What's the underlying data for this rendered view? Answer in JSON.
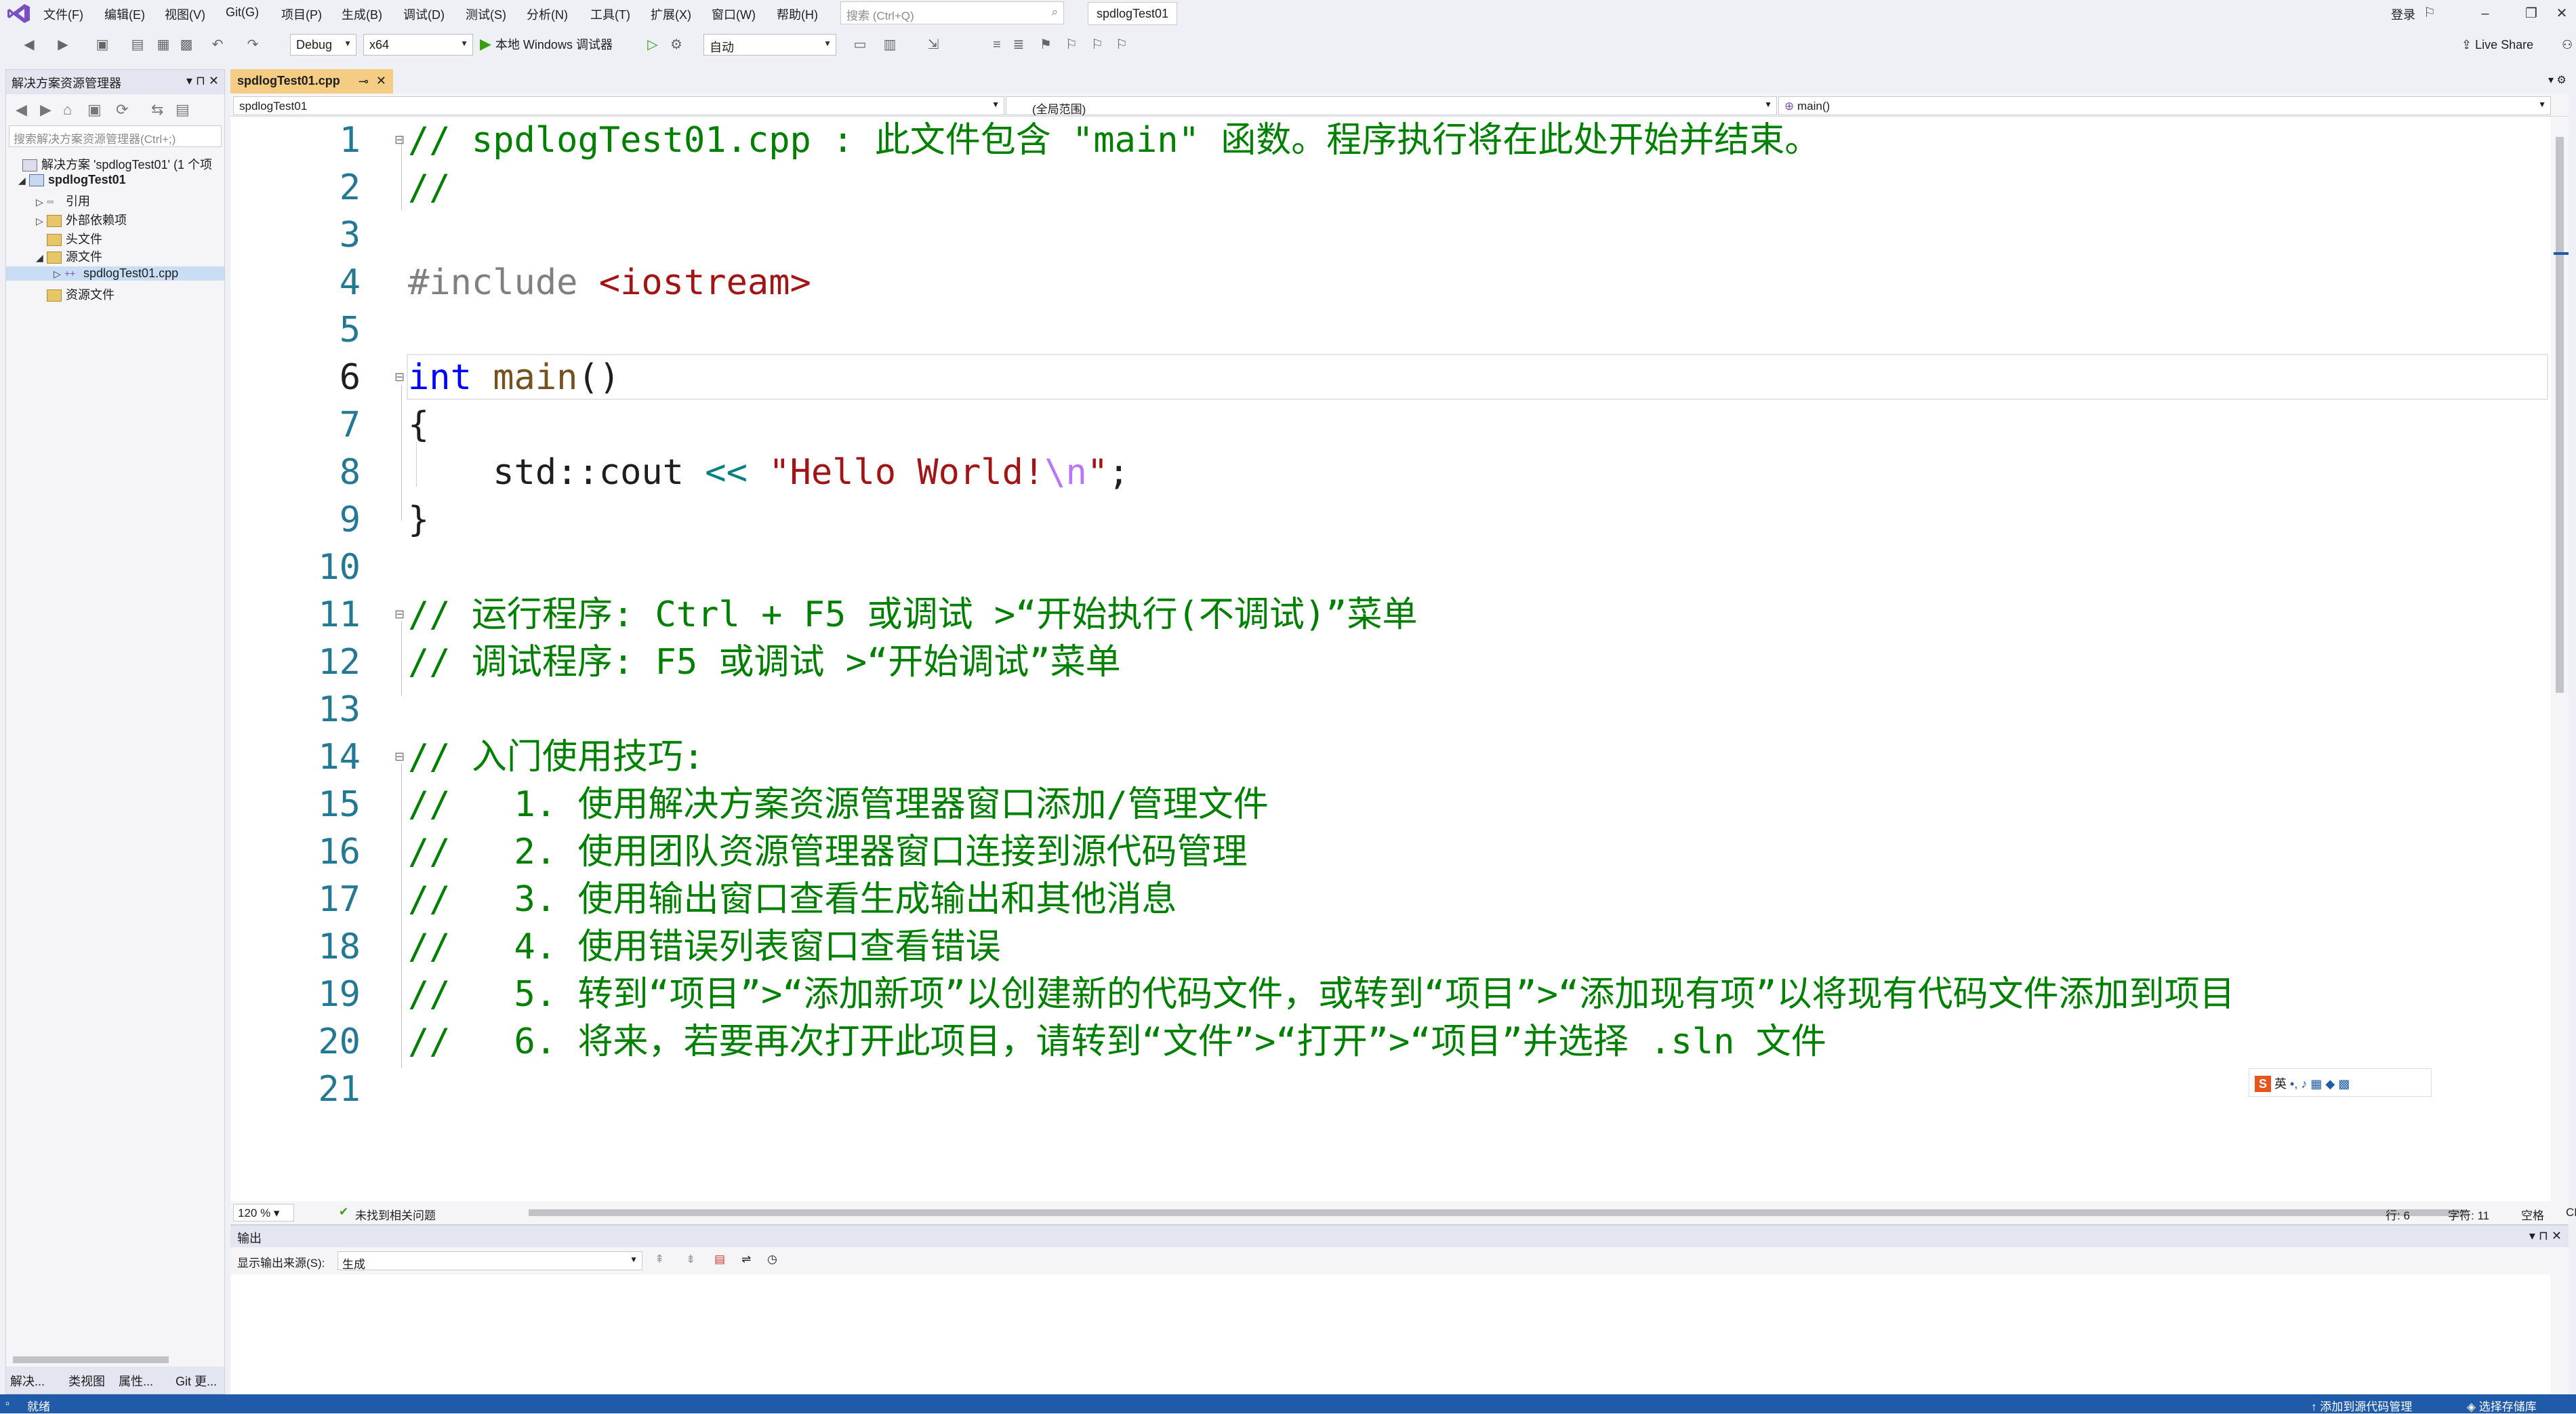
{
  "menu": [
    "文件(F)",
    "编辑(E)",
    "视图(V)",
    "Git(G)",
    "项目(P)",
    "生成(B)",
    "调试(D)",
    "测试(S)",
    "分析(N)",
    "工具(T)",
    "扩展(X)",
    "窗口(W)",
    "帮助(H)"
  ],
  "search": {
    "placeholder": "搜索 (Ctrl+Q)"
  },
  "solution_title": "spdlogTest01",
  "login": "登录",
  "toolbar": {
    "config": "Debug",
    "platform": "x64",
    "run": "本地 Windows 调试器",
    "auto": "自动",
    "live_share": "Live Share"
  },
  "solution_explorer": {
    "title": "解决方案资源管理器",
    "search_placeholder": "搜索解决方案资源管理器(Ctrl+;)",
    "items": [
      "解决方案 'spdlogTest01' (1 个项",
      "spdlogTest01",
      "引用",
      "外部依赖项",
      "头文件",
      "源文件",
      "spdlogTest01.cpp",
      "资源文件"
    ],
    "bottom_tabs": [
      "解决...",
      "类视图",
      "属性...",
      "Git 更..."
    ]
  },
  "editor": {
    "tab": "spdlogTest01.cpp",
    "nav": {
      "project": "spdlogTest01",
      "scope": "(全局范围)",
      "member": "main()"
    },
    "lines": [
      "1",
      "2",
      "3",
      "4",
      "5",
      "6",
      "7",
      "8",
      "9",
      "10",
      "11",
      "12",
      "13",
      "14",
      "15",
      "16",
      "17",
      "18",
      "19",
      "20",
      "21"
    ],
    "code": {
      "l1": "// spdlogTest01.cpp : 此文件包含 \"main\" 函数。程序执行将在此处开始并结束。",
      "l2": "//",
      "l4a": "#include ",
      "l4b": "<iostream>",
      "l6a": "int",
      "l6b": " main",
      "l6c": "()",
      "l7": "{",
      "l8a": "    std::cout ",
      "l8b": "<<",
      "l8c": " \"Hello World!",
      "l8d": "\\n",
      "l8e": "\"",
      ",": "",
      "l8f": ";",
      "l9": "}",
      "l11": "// 运行程序: Ctrl + F5 或调试 >“开始执行(不调试)”菜单",
      "l12": "// 调试程序: F5 或调试 >“开始调试”菜单",
      "l14": "// 入门使用技巧: ",
      "l15": "//   1. 使用解决方案资源管理器窗口添加/管理文件",
      "l16": "//   2. 使用团队资源管理器窗口连接到源代码管理",
      "l17": "//   3. 使用输出窗口查看生成输出和其他消息",
      "l18": "//   4. 使用错误列表窗口查看错误",
      "l19": "//   5. 转到“项目”>“添加新项”以创建新的代码文件，或转到“项目”>“添加现有项”以将现有代码文件添加到项目",
      "l20": "//   6. 将来，若要再次打开此项目，请转到“文件”>“打开”>“项目”并选择 .sln 文件"
    },
    "status": {
      "zoom": "120 %",
      "issues": "未找到相关问题",
      "line": "行: 6",
      "col": "字符: 11",
      "ws": "空格",
      "eol": "CRLF"
    }
  },
  "ime": {
    "lang": "英"
  },
  "output": {
    "title": "输出",
    "source_label": "显示输出来源(S):",
    "source": "生成"
  },
  "status": {
    "ready": "就绪",
    "add_source": "添加到源代码管理",
    "repo": "选择存储库"
  }
}
